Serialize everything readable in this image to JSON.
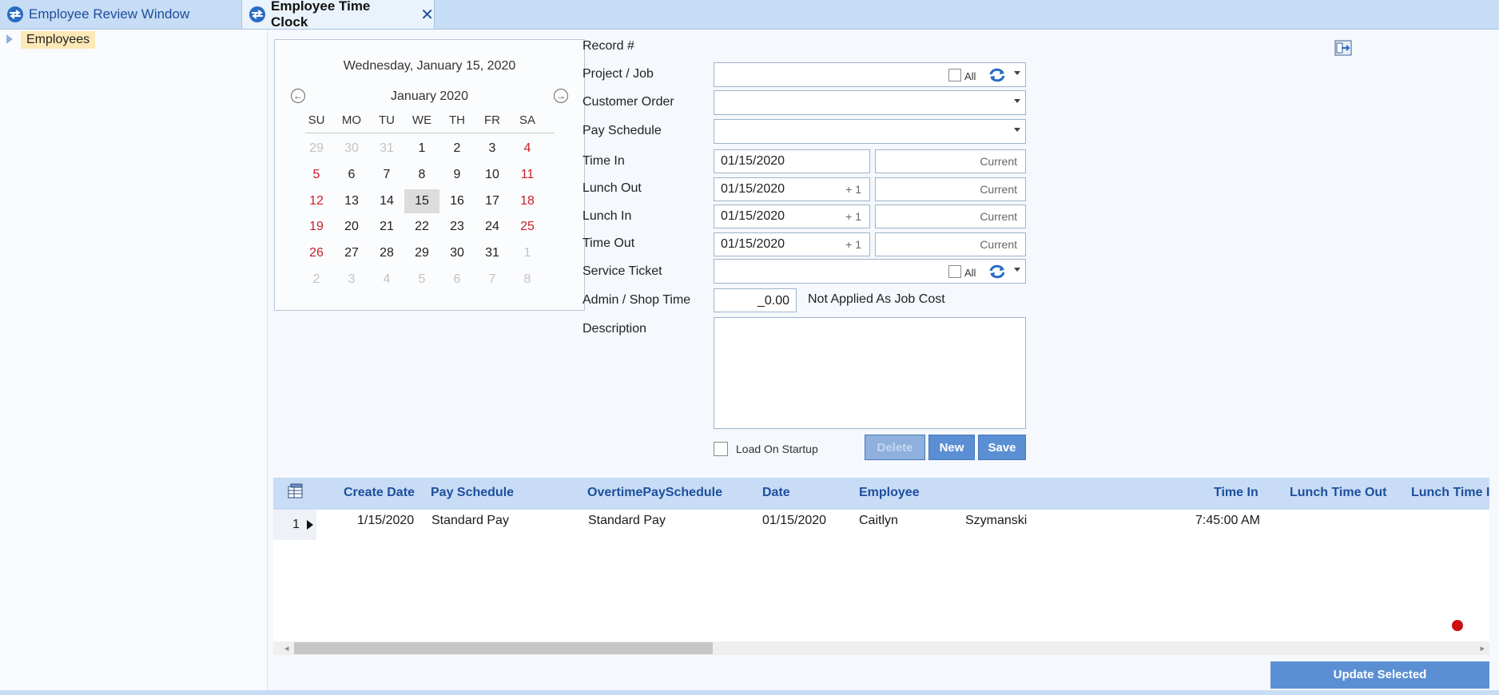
{
  "tabs": [
    {
      "label": "Employee Review Window",
      "active": false
    },
    {
      "label": "Employee Time Clock",
      "active": true,
      "close": "✕"
    }
  ],
  "tree": {
    "root": "Employees"
  },
  "calendar": {
    "full_date": "Wednesday, January 15, 2020",
    "month": "January 2020",
    "prev_glyph": "←",
    "next_glyph": "→",
    "dow": [
      "SU",
      "MO",
      "TU",
      "WE",
      "TH",
      "FR",
      "SA"
    ],
    "weeks": [
      [
        "29",
        "30",
        "31",
        "1",
        "2",
        "3",
        "4"
      ],
      [
        "5",
        "6",
        "7",
        "8",
        "9",
        "10",
        "11"
      ],
      [
        "12",
        "13",
        "14",
        "15",
        "16",
        "17",
        "18"
      ],
      [
        "19",
        "20",
        "21",
        "22",
        "23",
        "24",
        "25"
      ],
      [
        "26",
        "27",
        "28",
        "29",
        "30",
        "31",
        "1"
      ],
      [
        "2",
        "3",
        "4",
        "5",
        "6",
        "7",
        "8"
      ]
    ],
    "selected": "15"
  },
  "form": {
    "record": "Record #",
    "project_job": "Project / Job",
    "customer_order": "Customer Order",
    "pay_schedule": "Pay Schedule",
    "time_in": "Time In",
    "lunch_out": "Lunch Out",
    "lunch_in": "Lunch In",
    "time_out": "Time Out",
    "service_ticket": "Service Ticket",
    "admin_shop_time": "Admin / Shop Time",
    "description": "Description",
    "all_label": "All",
    "time_in_date": "01/15/2020",
    "lunch_out_date": "01/15/2020",
    "lunch_in_date": "01/15/2020",
    "time_out_date": "01/15/2020",
    "plus_one": "+ 1",
    "current": "Current",
    "admin_value": "_0.00",
    "not_applied": "Not Applied As Job Cost",
    "load_on_startup": "Load On Startup"
  },
  "buttons": {
    "delete": "Delete",
    "new": "New",
    "save": "Save",
    "update_selected": "Update Selected"
  },
  "grid": {
    "headers": [
      "Create Date",
      "Pay Schedule",
      "OvertimePaySchedule",
      "Date",
      "Employee",
      "Time In",
      "Lunch Time Out",
      "Lunch Time I"
    ],
    "row": {
      "num": "1",
      "create_date": "1/15/2020",
      "pay_schedule": "Standard Pay",
      "overtime_pay_schedule": "Standard Pay",
      "date": "01/15/2020",
      "first_name": "Caitlyn",
      "last_name": "Szymanski",
      "time_in": "7:45:00 AM"
    }
  },
  "colors": {
    "accent": "#5b8fd3",
    "weekend": "#c8202a",
    "tab_bg": "#c7dcf5",
    "header_text": "#1d4f9c"
  }
}
